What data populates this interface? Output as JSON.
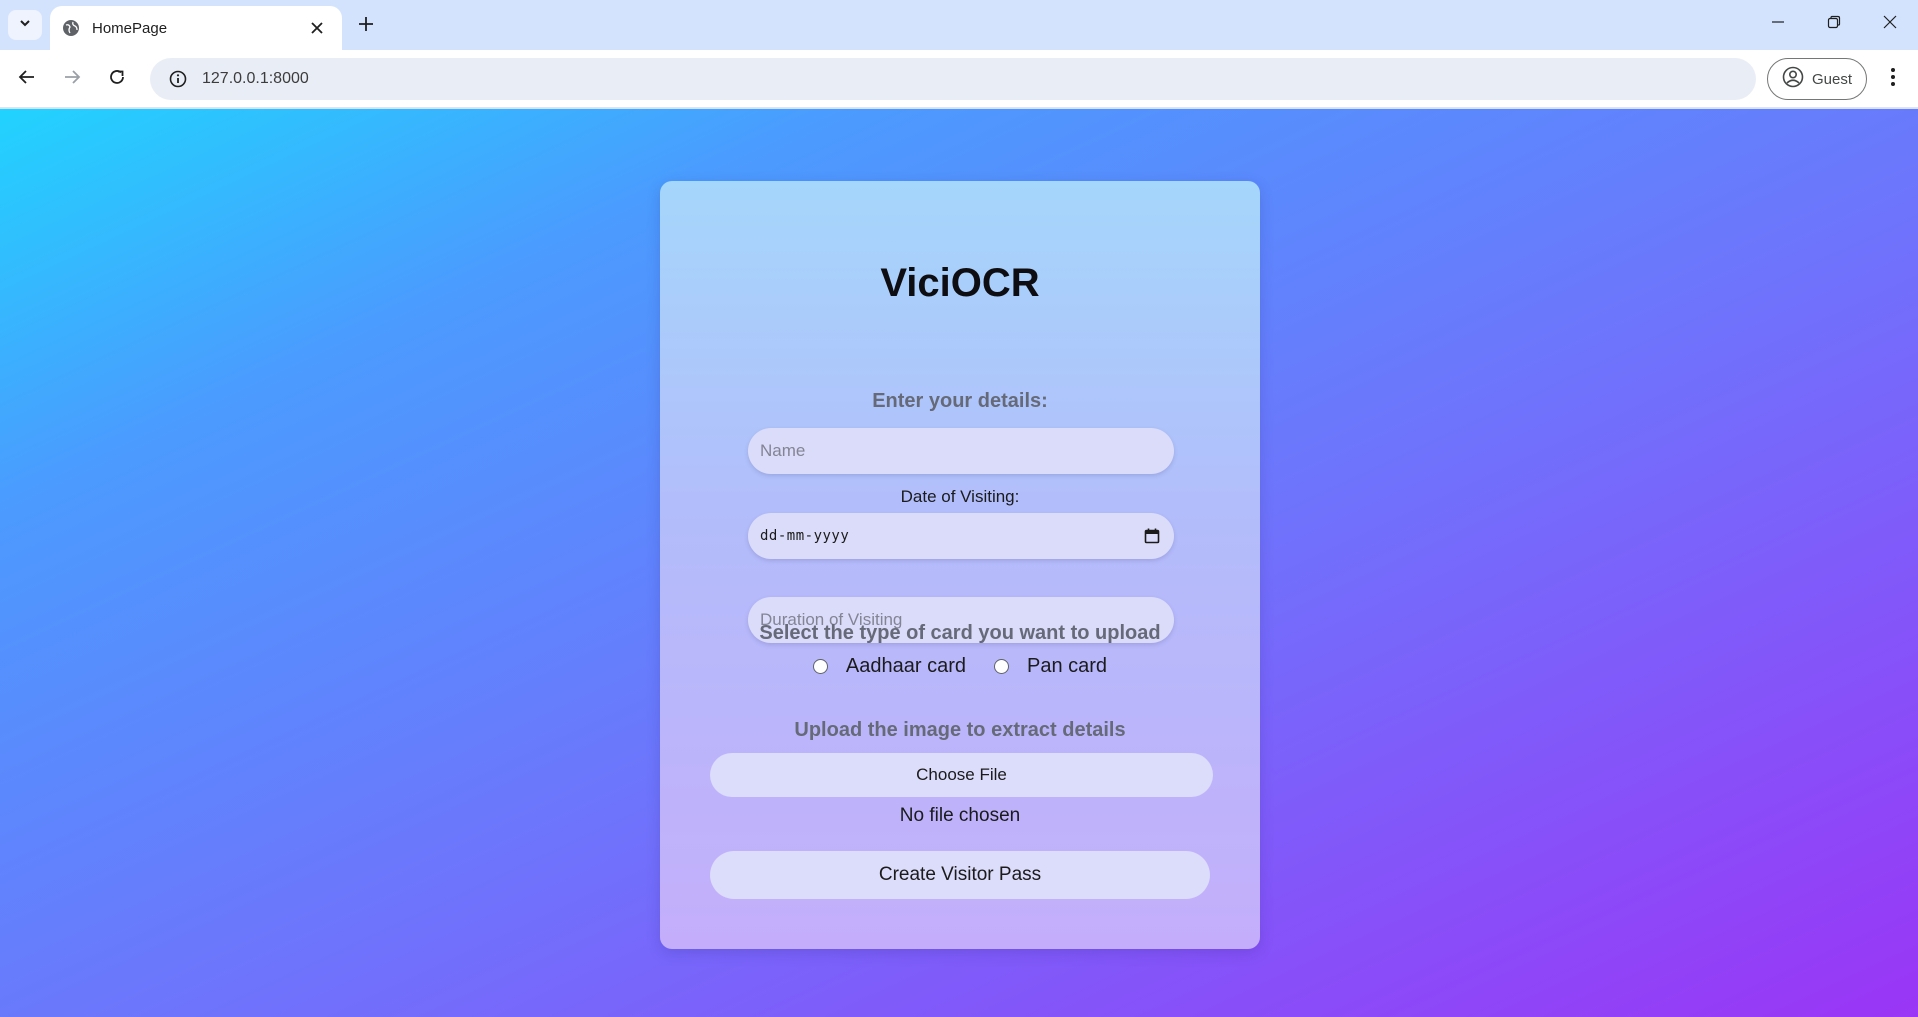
{
  "browser": {
    "tab_title": "HomePage",
    "url": "127.0.0.1:8000",
    "profile_label": "Guest"
  },
  "form": {
    "title": "ViciOCR",
    "subtitle": "Enter your details:",
    "name_placeholder": "Name",
    "date_label": "Date of Visiting:",
    "date_value": "dd-mm-yyyy",
    "duration_placeholder": "Duration of Visiting",
    "card_type_label": "Select the type of card you want to upload",
    "card_options": [
      "Aadhaar card",
      "Pan card"
    ],
    "upload_label": "Upload the image to extract details",
    "choose_file_label": "Choose File",
    "no_file_text": "No file chosen",
    "submit_label": "Create Visitor Pass"
  },
  "icons": {
    "tab_search": "chevron-down-icon",
    "favicon": "globe-icon",
    "tab_close": "close-icon",
    "new_tab": "plus-icon",
    "back": "arrow-left-icon",
    "forward": "arrow-right-icon",
    "reload": "reload-icon",
    "site_info": "info-icon",
    "profile": "account-circle-icon",
    "menu": "kebab-menu-icon",
    "calendar": "calendar-icon"
  }
}
